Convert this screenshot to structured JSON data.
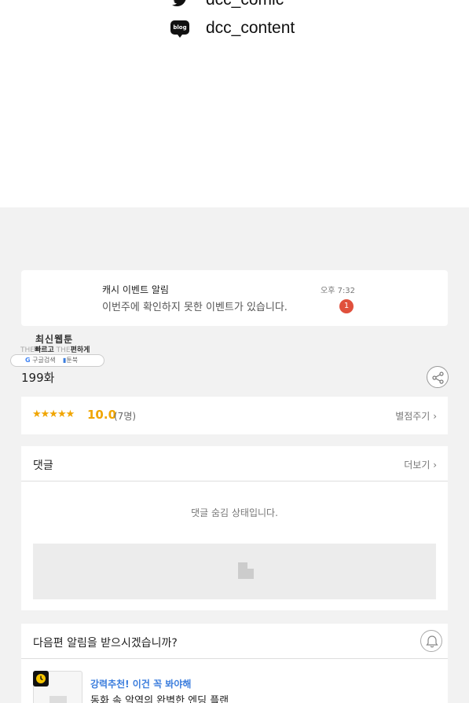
{
  "social": [
    {
      "icon": "twitter-icon",
      "handle": "dcc_comic"
    },
    {
      "icon": "blog-icon",
      "icon_text": "blog",
      "handle": "dcc_content"
    }
  ],
  "notification": {
    "title": "캐시 이벤트 알림",
    "body": "이번주에 확인하지 못한 이벤트가 있습니다.",
    "time": "오후 7:32",
    "badge": "1"
  },
  "logo": {
    "main": "최신웹툰",
    "sub_prefix1": "THE",
    "sub_word1": "빠르고",
    "sub_prefix2": "THE",
    "sub_word2": "편하게",
    "search_label": "구글검색",
    "brand_label": "툰북"
  },
  "episode": {
    "label": "199화"
  },
  "rating": {
    "stars": "★★★★★",
    "score": "10.0",
    "count": "(7명)",
    "rate_link": "별점주기"
  },
  "comments": {
    "title": "댓글",
    "more": "더보기",
    "hidden_message": "댓글 숨김 상태입니다."
  },
  "alarm": {
    "question": "다음편 알림을 받으시겠습니까?"
  },
  "recommend": {
    "tag": "강력추천! 이건 꼭 봐야해",
    "title": "동화 속 악역의 완벽한 엔딩 플랜"
  },
  "colors": {
    "accent_star": "#f0a500",
    "badge": "#e0503c",
    "rec_tag": "#3b7ddd",
    "background_gray": "#f2f2f2"
  }
}
